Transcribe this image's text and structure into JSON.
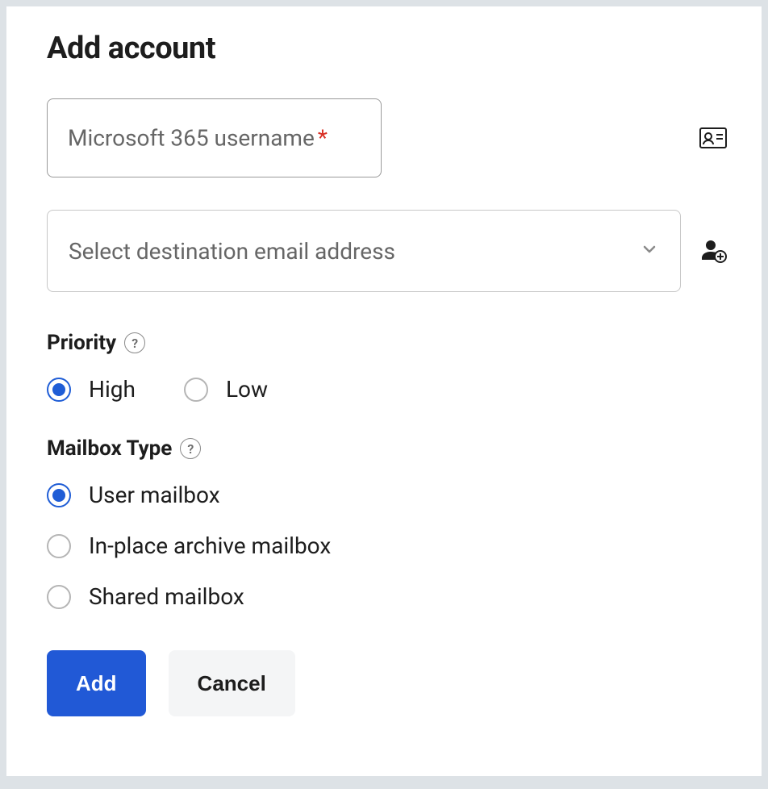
{
  "title": "Add account",
  "username_field": {
    "label": "Microsoft 365 username",
    "required_mark": "*",
    "value": ""
  },
  "destination_select": {
    "placeholder": "Select destination email address"
  },
  "priority": {
    "label": "Priority",
    "options": [
      {
        "label": "High",
        "selected": true
      },
      {
        "label": "Low",
        "selected": false
      }
    ]
  },
  "mailbox_type": {
    "label": "Mailbox Type",
    "options": [
      {
        "label": "User mailbox",
        "selected": true
      },
      {
        "label": "In-place archive mailbox",
        "selected": false
      },
      {
        "label": "Shared mailbox",
        "selected": false
      }
    ]
  },
  "buttons": {
    "add": "Add",
    "cancel": "Cancel"
  }
}
